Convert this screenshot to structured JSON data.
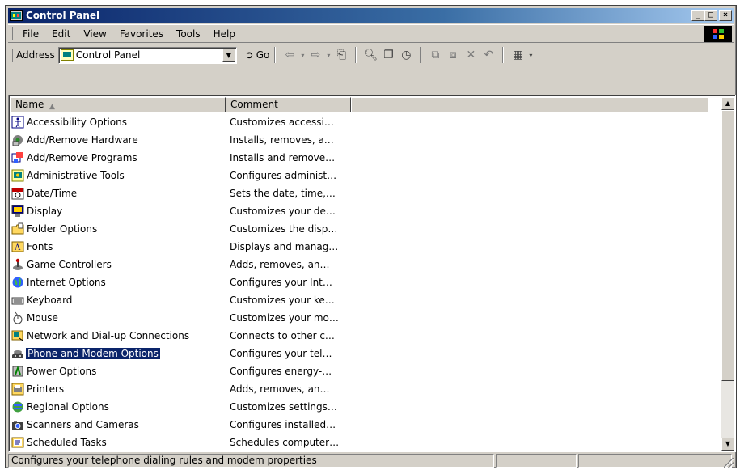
{
  "window": {
    "title": "Control Panel"
  },
  "caption_buttons": {
    "minimize": "_",
    "maximize": "□",
    "close": "×"
  },
  "menu": [
    "File",
    "Edit",
    "View",
    "Favorites",
    "Tools",
    "Help"
  ],
  "address": {
    "label": "Address",
    "value": "Control Panel",
    "go": "Go"
  },
  "toolbar_icons": [
    "back-icon",
    "forward-icon",
    "up-folder-icon",
    "search-icon",
    "folders-icon",
    "history-icon",
    "move-to-icon",
    "copy-to-icon",
    "delete-icon",
    "undo-icon",
    "views-icon"
  ],
  "list": {
    "columns": [
      "Name",
      "Comment"
    ],
    "rows": [
      {
        "name": "Accessibility Options",
        "comment": "Customizes accessi…",
        "icon": "accessibility-icon"
      },
      {
        "name": "Add/Remove Hardware",
        "comment": "Installs, removes, a…",
        "icon": "hardware-icon"
      },
      {
        "name": "Add/Remove Programs",
        "comment": "Installs and remove…",
        "icon": "programs-icon"
      },
      {
        "name": "Administrative Tools",
        "comment": "Configures administ…",
        "icon": "admin-tools-icon"
      },
      {
        "name": "Date/Time",
        "comment": "Sets the date, time,…",
        "icon": "calendar-icon"
      },
      {
        "name": "Display",
        "comment": "Customizes your de…",
        "icon": "monitor-icon"
      },
      {
        "name": "Folder Options",
        "comment": "Customizes the disp…",
        "icon": "folder-icon"
      },
      {
        "name": "Fonts",
        "comment": "Displays and manag…",
        "icon": "fonts-icon"
      },
      {
        "name": "Game Controllers",
        "comment": "Adds, removes, an…",
        "icon": "joystick-icon"
      },
      {
        "name": "Internet Options",
        "comment": "Configures your Int…",
        "icon": "globe-icon"
      },
      {
        "name": "Keyboard",
        "comment": "Customizes your ke…",
        "icon": "keyboard-icon"
      },
      {
        "name": "Mouse",
        "comment": "Customizes your mo…",
        "icon": "mouse-icon"
      },
      {
        "name": "Network and Dial-up Connections",
        "comment": "Connects to other c…",
        "icon": "network-icon"
      },
      {
        "name": "Phone and Modem Options",
        "comment": "Configures your tel…",
        "icon": "phone-icon",
        "selected": true
      },
      {
        "name": "Power Options",
        "comment": "Configures energy-…",
        "icon": "power-icon"
      },
      {
        "name": "Printers",
        "comment": "Adds, removes, an…",
        "icon": "printer-icon"
      },
      {
        "name": "Regional Options",
        "comment": "Customizes settings…",
        "icon": "regional-icon"
      },
      {
        "name": "Scanners and Cameras",
        "comment": "Configures installed…",
        "icon": "camera-icon"
      },
      {
        "name": "Scheduled Tasks",
        "comment": "Schedules computer…",
        "icon": "tasks-icon"
      }
    ]
  },
  "status": {
    "text": "Configures your telephone dialing rules and modem properties"
  },
  "colors": {
    "selection": "#0a246a",
    "titlebar": "#0a246a",
    "face": "#d4d0c8"
  }
}
